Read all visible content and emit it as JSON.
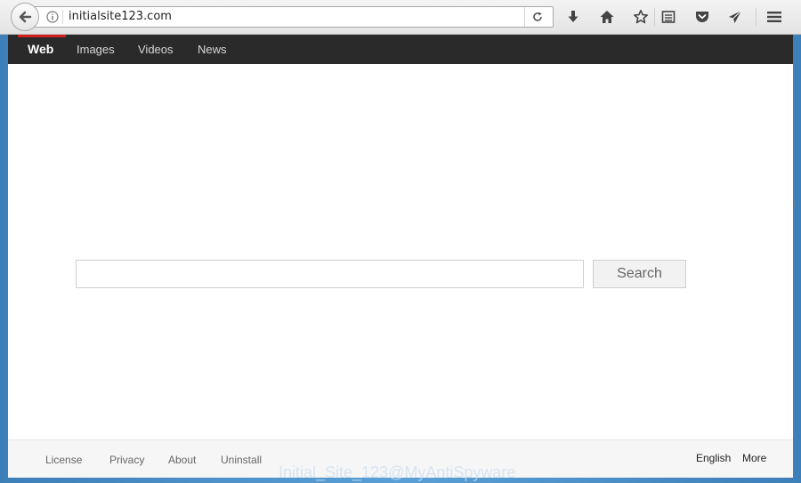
{
  "browser": {
    "url": "initialsite123.com"
  },
  "navbar": {
    "items": [
      {
        "label": "Web",
        "active": true
      },
      {
        "label": "Images",
        "active": false
      },
      {
        "label": "Videos",
        "active": false
      },
      {
        "label": "News",
        "active": false
      }
    ],
    "active_color": "#d21f1f"
  },
  "search": {
    "value": "",
    "button_label": "Search"
  },
  "footer": {
    "left_links": [
      "License",
      "Privacy",
      "About",
      "Uninstall"
    ],
    "right_links": [
      "English",
      "More"
    ]
  },
  "watermark": "Initial_Site_123@MyAntiSpyware",
  "icons": {
    "back": "back-arrow-icon",
    "info": "info-icon",
    "reload": "reload-icon",
    "download": "download-icon",
    "home": "home-icon",
    "bookmark": "star-icon",
    "reading_list": "reading-list-icon",
    "pocket": "pocket-icon",
    "send": "send-icon",
    "menu": "hamburger-menu-icon"
  }
}
